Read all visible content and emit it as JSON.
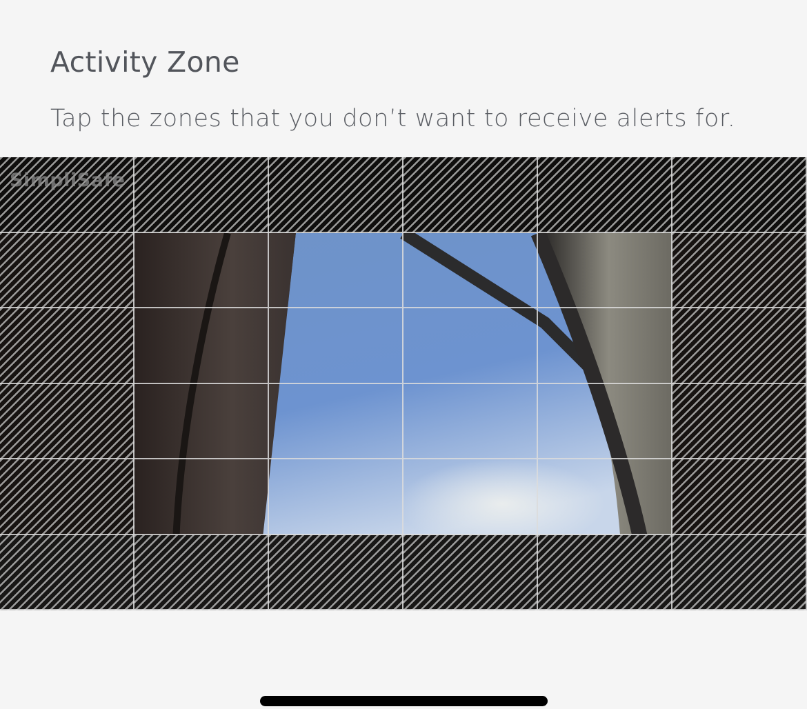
{
  "header": {
    "title": "Activity Zone",
    "subtitle": "Tap the zones that you don’t want to receive alerts for."
  },
  "camera": {
    "watermark": "SimpliSafe",
    "grid": {
      "columns": 6,
      "rows": 6,
      "excluded_cells": [
        [
          true,
          true,
          true,
          true,
          true,
          true
        ],
        [
          true,
          false,
          false,
          false,
          false,
          true
        ],
        [
          true,
          false,
          false,
          false,
          false,
          true
        ],
        [
          true,
          false,
          false,
          false,
          false,
          true
        ],
        [
          true,
          false,
          false,
          false,
          false,
          true
        ],
        [
          true,
          true,
          true,
          true,
          true,
          true
        ]
      ]
    }
  },
  "colors": {
    "background": "#f5f5f5",
    "text": "#52555b",
    "grid_line": "#dcdcdc",
    "home_indicator": "#000000"
  }
}
